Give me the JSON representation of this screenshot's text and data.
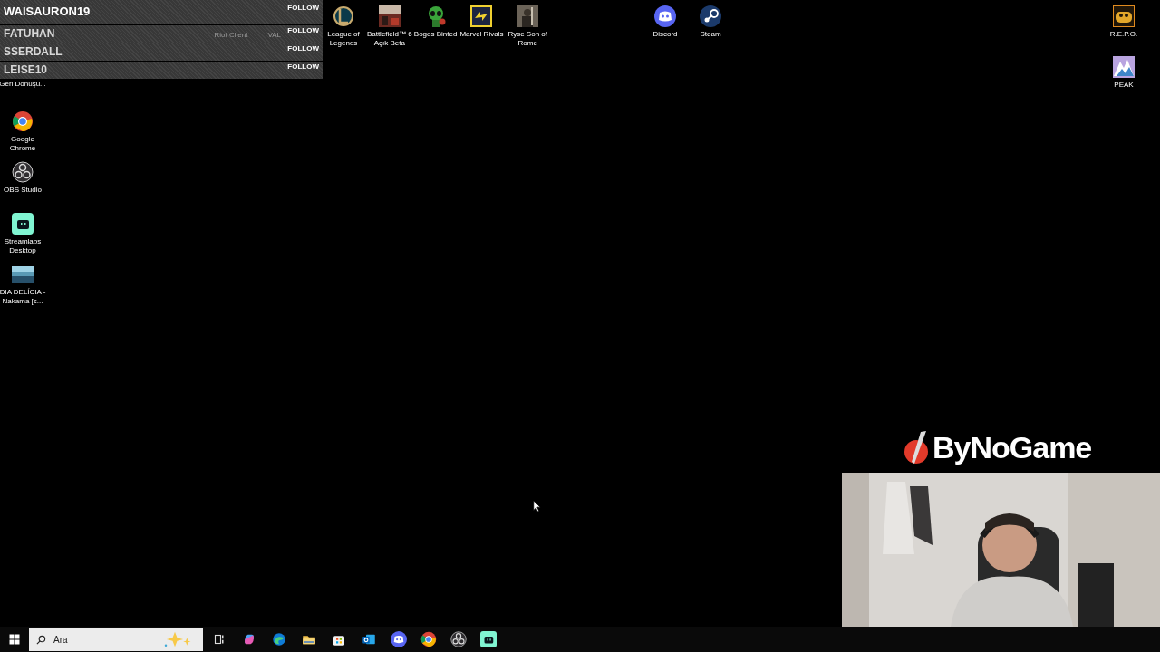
{
  "overlay": {
    "rows": [
      {
        "name": "WAISAURON19",
        "action": "FOLLOW"
      },
      {
        "name": "FATUHAN",
        "action": "FOLLOW"
      },
      {
        "name": "SSERDALL",
        "action": "FOLLOW"
      },
      {
        "name": "LEISE10",
        "action": "FOLLOW"
      }
    ],
    "obscured_labels": [
      "Riot Client",
      "VAL"
    ]
  },
  "desktop": {
    "left_column": [
      {
        "label": "Geri Dönüşü...",
        "kind": "covered"
      },
      {
        "label": "Google Chrome",
        "kind": "chrome"
      },
      {
        "label": "OBS Studio",
        "kind": "obs"
      },
      {
        "label": "Streamlabs Desktop",
        "kind": "streamlabs"
      },
      {
        "label": "DIA DELÍCIA - Nakama [s...",
        "kind": "thumbnail"
      }
    ],
    "top_row": [
      {
        "label": "League of Legends",
        "kind": "league"
      },
      {
        "label": "Battlefield™ 6 Açık Beta",
        "kind": "battlefield"
      },
      {
        "label": "Bogos Binted",
        "kind": "alien"
      },
      {
        "label": "Marvel Rivals",
        "kind": "marvel"
      },
      {
        "label": "Ryse Son of Rome",
        "kind": "ryse"
      }
    ],
    "top_apps": [
      {
        "label": "Discord",
        "kind": "discord"
      },
      {
        "label": "Steam",
        "kind": "steam"
      }
    ],
    "right_column": [
      {
        "label": "R.E.P.O.",
        "kind": "repo"
      },
      {
        "label": "PEAK",
        "kind": "peak"
      }
    ]
  },
  "brand": {
    "name": "ByNoGame"
  },
  "taskbar": {
    "search": {
      "placeholder": "Ara"
    },
    "apps": [
      {
        "kind": "taskview"
      },
      {
        "kind": "copilot"
      },
      {
        "kind": "edge"
      },
      {
        "kind": "explorer"
      },
      {
        "kind": "store"
      },
      {
        "kind": "outlook"
      },
      {
        "kind": "discord"
      },
      {
        "kind": "chrome"
      },
      {
        "kind": "obs"
      },
      {
        "kind": "streamlabs"
      }
    ]
  }
}
